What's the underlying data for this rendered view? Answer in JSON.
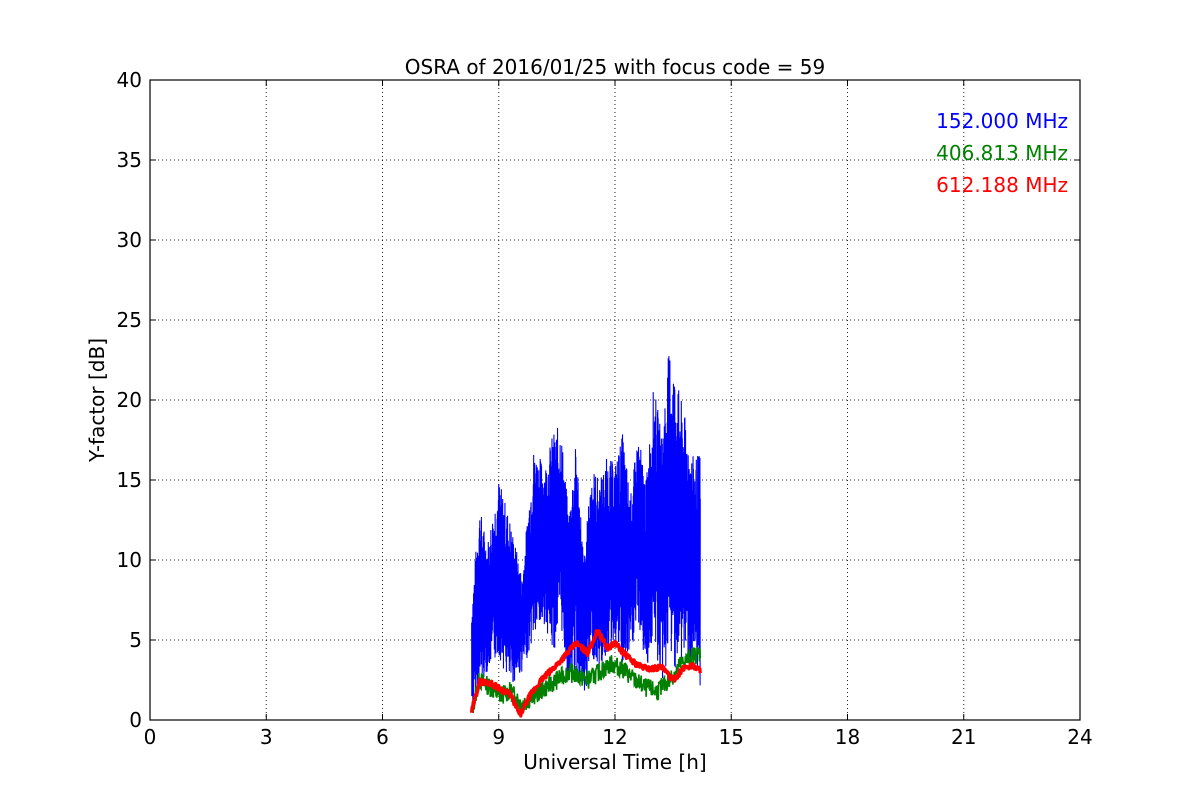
{
  "chart_data": {
    "type": "line",
    "title": "OSRA of 2016/01/25 with focus code = 59",
    "xlabel": "Universal Time [h]",
    "ylabel": "Y-factor [dB]",
    "xlim": [
      0,
      24
    ],
    "ylim": [
      0,
      40
    ],
    "xticks": [
      0,
      3,
      6,
      9,
      12,
      15,
      18,
      21,
      24
    ],
    "yticks": [
      0,
      5,
      10,
      15,
      20,
      25,
      30,
      35,
      40
    ],
    "grid": true,
    "legend_position": "top-right",
    "series": [
      {
        "name": "152.000 MHz",
        "color": "#0000ff",
        "envelope_x": [
          8.3,
          8.5,
          8.7,
          9.0,
          9.3,
          9.6,
          9.9,
          10.2,
          10.4,
          10.6,
          10.8,
          11.0,
          11.2,
          11.4,
          11.6,
          11.8,
          12.0,
          12.2,
          12.4,
          12.6,
          12.8,
          13.0,
          13.2,
          13.4,
          13.6,
          13.8,
          14.0,
          14.2
        ],
        "envelope_min": [
          0.5,
          2.0,
          3.0,
          4.0,
          2.0,
          3.0,
          5.0,
          6.0,
          4.0,
          6.0,
          2.0,
          3.0,
          1.0,
          4.0,
          3.0,
          4.0,
          5.0,
          3.0,
          4.0,
          6.0,
          3.0,
          5.0,
          2.0,
          4.0,
          3.0,
          4.0,
          3.0,
          2.0
        ],
        "envelope_max": [
          7.2,
          13.5,
          11.0,
          15.1,
          12.5,
          9.0,
          17.0,
          16.0,
          18.0,
          18.5,
          13.0,
          17.5,
          10.0,
          16.0,
          15.0,
          16.5,
          16.0,
          18.0,
          14.0,
          18.0,
          15.0,
          21.0,
          18.0,
          23.4,
          21.2,
          19.0,
          16.5,
          16.7
        ]
      },
      {
        "name": "406.813 MHz",
        "color": "#008000",
        "x": [
          8.3,
          8.5,
          8.8,
          9.0,
          9.3,
          9.6,
          9.9,
          10.2,
          10.5,
          10.8,
          11.0,
          11.3,
          11.6,
          11.9,
          12.2,
          12.5,
          12.8,
          13.1,
          13.4,
          13.7,
          14.0,
          14.2
        ],
        "y": [
          0.5,
          2.5,
          2.0,
          1.5,
          1.8,
          1.0,
          1.5,
          2.0,
          2.5,
          3.0,
          2.8,
          2.5,
          3.0,
          3.5,
          3.2,
          2.5,
          2.0,
          1.8,
          2.5,
          3.5,
          4.0,
          4.2
        ]
      },
      {
        "name": "612.188 MHz",
        "color": "#ff0000",
        "x": [
          8.3,
          8.5,
          8.8,
          9.0,
          9.3,
          9.55,
          9.8,
          10.1,
          10.4,
          10.7,
          11.0,
          11.3,
          11.55,
          11.8,
          12.0,
          12.3,
          12.6,
          12.9,
          13.2,
          13.5,
          13.8,
          14.0,
          14.2
        ],
        "y": [
          0.5,
          2.4,
          2.3,
          2.0,
          1.6,
          0.3,
          1.5,
          2.5,
          3.2,
          4.0,
          4.8,
          4.2,
          5.6,
          4.5,
          4.8,
          4.0,
          3.4,
          3.2,
          3.3,
          2.5,
          3.3,
          3.4,
          3.1
        ]
      }
    ]
  }
}
